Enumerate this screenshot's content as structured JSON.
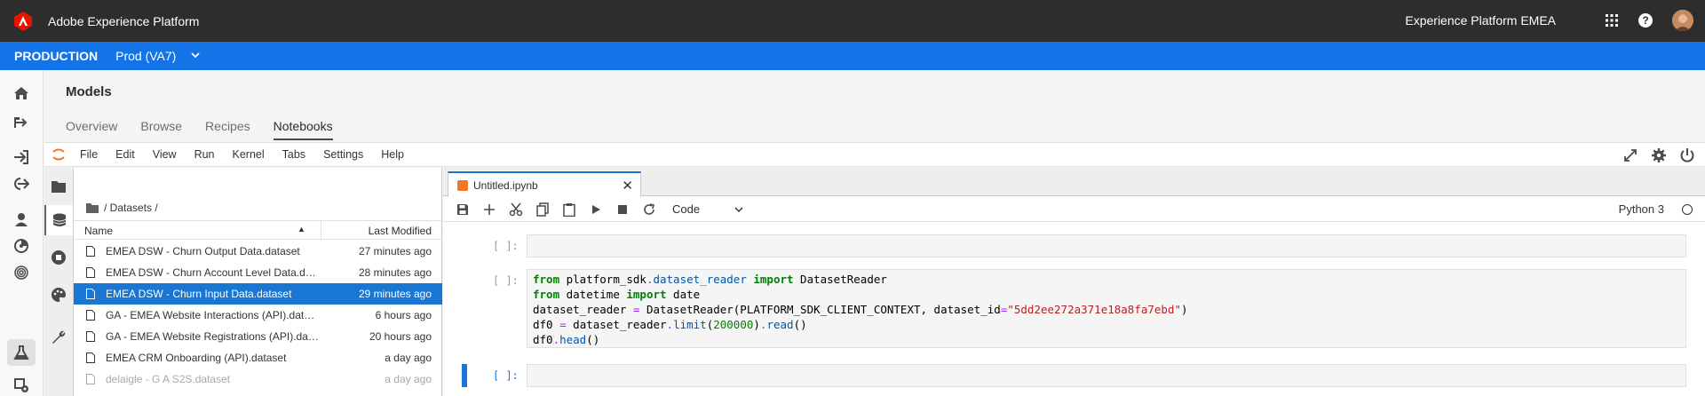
{
  "topbar": {
    "app_title": "Adobe Experience Platform",
    "org_name": "Experience Platform EMEA",
    "icons": [
      "adobe-logo",
      "apps-grid-icon",
      "help-icon",
      "user-avatar"
    ]
  },
  "sandbox": {
    "environment": "PRODUCTION",
    "name": "Prod (VA7)"
  },
  "rail": {
    "icons": [
      "home-icon",
      "workflows-icon",
      "sources-icon",
      "destinations-icon",
      "profiles-icon",
      "segments-icon",
      "identities-icon",
      "models-icon",
      "settings-icon"
    ],
    "active": "models-icon"
  },
  "header": {
    "title": "Models",
    "tabs": [
      {
        "label": "Overview"
      },
      {
        "label": "Browse"
      },
      {
        "label": "Recipes"
      },
      {
        "label": "Notebooks"
      }
    ],
    "active_tab": "Notebooks"
  },
  "jupyter_menu": {
    "items": [
      "File",
      "Edit",
      "View",
      "Run",
      "Kernel",
      "Tabs",
      "Settings",
      "Help"
    ]
  },
  "filebrowser": {
    "breadcrumb": "/ Datasets /",
    "col_name": "Name",
    "col_modified": "Last Modified",
    "files": [
      {
        "name": "EMEA DSW - Churn Output Data.dataset",
        "modified": "27 minutes ago"
      },
      {
        "name": "EMEA DSW - Churn Account Level Data.dataset",
        "modified": "28 minutes ago"
      },
      {
        "name": "EMEA DSW - Churn Input Data.dataset",
        "modified": "29 minutes ago"
      },
      {
        "name": "GA - EMEA Website Interactions (API).dataset",
        "modified": "6 hours ago"
      },
      {
        "name": "GA - EMEA Website Registrations (API).dataset",
        "modified": "20 hours ago"
      },
      {
        "name": "EMEA CRM Onboarding (API).dataset",
        "modified": "a day ago"
      },
      {
        "name": "delaigle - G A S2S.dataset",
        "modified": "a day ago"
      }
    ],
    "selected_index": 2
  },
  "notebook": {
    "tab_name": "Untitled.ipynb",
    "cell_type": "Code",
    "kernel": "Python 3",
    "cells": [
      {
        "prompt": "[ ]:"
      },
      {
        "prompt": "[ ]:",
        "lines": [
          "from platform_sdk.dataset_reader import DatasetReader",
          "from datetime import date",
          "dataset_reader = DatasetReader(PLATFORM_SDK_CLIENT_CONTEXT, dataset_id=\"5dd2ee272a371e18a8fa7ebd\")",
          "df0 = dataset_reader.limit(200000).read()",
          "df0.head()"
        ]
      },
      {
        "prompt": "[ ]:"
      }
    ]
  }
}
